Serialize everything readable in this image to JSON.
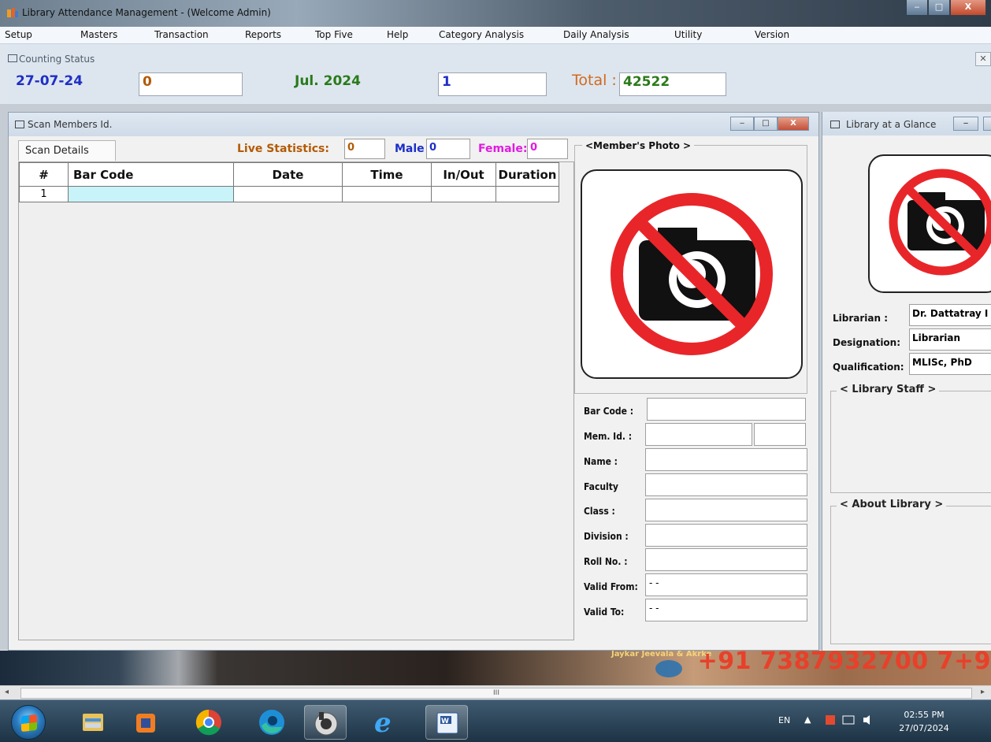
{
  "window": {
    "title": "Library Attendance Management - (Welcome Admin)",
    "min": "‒",
    "max": "□",
    "close": "X"
  },
  "menu": [
    "Setup",
    "Masters",
    "Transaction",
    "Reports",
    "Top Five",
    "Help",
    "Category Analysis",
    "Daily Analysis",
    "Utility",
    "Version"
  ],
  "counting": {
    "header": "Counting Status",
    "close": "✕",
    "date": "27-07-24",
    "day_count": "0",
    "month": "Jul. 2024",
    "month_count": "1",
    "total_label": "Total :",
    "total_value": "42522"
  },
  "scan": {
    "title": "Scan Members Id.",
    "tab": "Scan Details",
    "live_label": "Live Statistics:",
    "live_value": "0",
    "male_label": "Male",
    "male_value": "0",
    "female_label": "Female:",
    "female_value": "0",
    "columns": [
      "#",
      "Bar Code",
      "Date",
      "Time",
      "In/Out",
      "Duration"
    ],
    "rows": [
      [
        "1",
        "",
        "",
        "",
        "",
        ""
      ]
    ],
    "photo_caption": "<Member's Photo >",
    "fields": [
      {
        "label": "Bar Code :",
        "value": ""
      },
      {
        "label": "Mem. Id. :",
        "value": ""
      },
      {
        "label": "Name :",
        "value": ""
      },
      {
        "label": "Faculty",
        "value": ""
      },
      {
        "label": "Class :",
        "value": ""
      },
      {
        "label": "Division :",
        "value": ""
      },
      {
        "label": "Roll No. :",
        "value": ""
      },
      {
        "label": "Valid From:",
        "value": "- -"
      },
      {
        "label": "Valid To:",
        "value": "- -"
      }
    ]
  },
  "glance": {
    "title": "Library at a Glance",
    "librarian_label": "Librarian :",
    "librarian_value": "Dr. Dattatray I",
    "designation_label": "Designation:",
    "designation_value": "Librarian",
    "qualification_label": "Qualification:",
    "qualification_value": "MLISc, PhD",
    "staff_caption": "< Library Staff >",
    "about_caption": "< About Library >"
  },
  "banner": {
    "phone": "+91 7387932700 7+9",
    "small": "Jaykar Jeevala & Akrke"
  },
  "scrollbar": {
    "grip": "III"
  },
  "taskbar": {
    "lang": "EN",
    "tray_arrow": "▲",
    "time": "02:55 PM",
    "date": "27/07/2024"
  },
  "colors": {
    "date_blue": "#1f2fc4",
    "count_orange": "#b35a05",
    "month_green": "#2a7a1a",
    "male_blue": "#1b2ec9",
    "female_magenta": "#e01be0"
  }
}
